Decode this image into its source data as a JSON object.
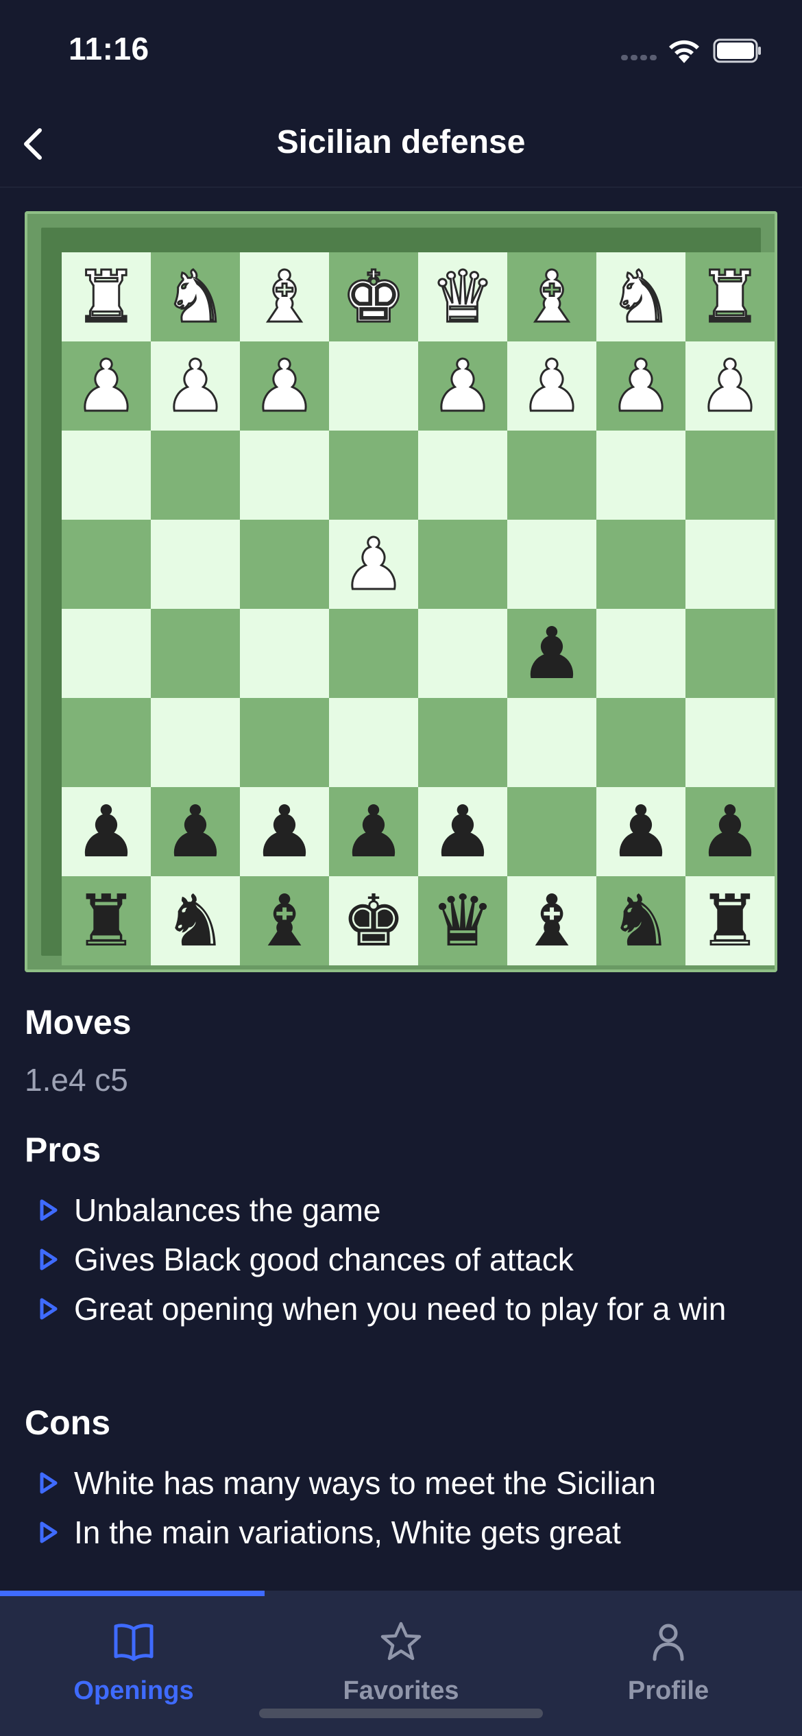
{
  "status_bar": {
    "time": "11:16"
  },
  "nav": {
    "title": "Sicilian defense",
    "back_icon": "chevron-left-icon"
  },
  "board": {
    "rows": [
      [
        {
          "p": "♜",
          "c": "w"
        },
        {
          "p": "♞",
          "c": "w"
        },
        {
          "p": "♝",
          "c": "w"
        },
        {
          "p": "♚",
          "c": "w"
        },
        {
          "p": "♛",
          "c": "w"
        },
        {
          "p": "♝",
          "c": "w"
        },
        {
          "p": "♞",
          "c": "w"
        },
        {
          "p": "♜",
          "c": "w"
        }
      ],
      [
        {
          "p": "♟",
          "c": "w"
        },
        {
          "p": "♟",
          "c": "w"
        },
        {
          "p": "♟",
          "c": "w"
        },
        null,
        {
          "p": "♟",
          "c": "w"
        },
        {
          "p": "♟",
          "c": "w"
        },
        {
          "p": "♟",
          "c": "w"
        },
        {
          "p": "♟",
          "c": "w"
        }
      ],
      [
        null,
        null,
        null,
        null,
        null,
        null,
        null,
        null
      ],
      [
        null,
        null,
        null,
        {
          "p": "♟",
          "c": "w"
        },
        null,
        null,
        null,
        null
      ],
      [
        null,
        null,
        null,
        null,
        null,
        {
          "p": "♟",
          "c": "b"
        },
        null,
        null
      ],
      [
        null,
        null,
        null,
        null,
        null,
        null,
        null,
        null
      ],
      [
        {
          "p": "♟",
          "c": "b"
        },
        {
          "p": "♟",
          "c": "b"
        },
        {
          "p": "♟",
          "c": "b"
        },
        {
          "p": "♟",
          "c": "b"
        },
        {
          "p": "♟",
          "c": "b"
        },
        null,
        {
          "p": "♟",
          "c": "b"
        },
        {
          "p": "♟",
          "c": "b"
        }
      ],
      [
        {
          "p": "♜",
          "c": "b"
        },
        {
          "p": "♞",
          "c": "b"
        },
        {
          "p": "♝",
          "c": "b"
        },
        {
          "p": "♚",
          "c": "b"
        },
        {
          "p": "♛",
          "c": "b"
        },
        {
          "p": "♝",
          "c": "b"
        },
        {
          "p": "♞",
          "c": "b"
        },
        {
          "p": "♜",
          "c": "b"
        }
      ]
    ]
  },
  "moves": {
    "title": "Moves",
    "value": "1.e4 c5"
  },
  "pros": {
    "title": "Pros",
    "items": [
      "Unbalances the game",
      "Gives Black good chances of attack",
      "Great opening when you need to play for a win"
    ]
  },
  "cons": {
    "title": "Cons",
    "items": [
      "White has many ways to meet the Sicilian",
      "In the main variations, White gets great"
    ]
  },
  "tabs": [
    {
      "label": "Openings",
      "icon": "book-icon",
      "active": true
    },
    {
      "label": "Favorites",
      "icon": "star-icon",
      "active": false
    },
    {
      "label": "Profile",
      "icon": "person-icon",
      "active": false
    }
  ],
  "colors": {
    "background": "#161a2e",
    "accent": "#3f6bff",
    "board_light": "#e6fbe4",
    "board_dark": "#7fb377"
  },
  "scroll_progress": 0.33
}
